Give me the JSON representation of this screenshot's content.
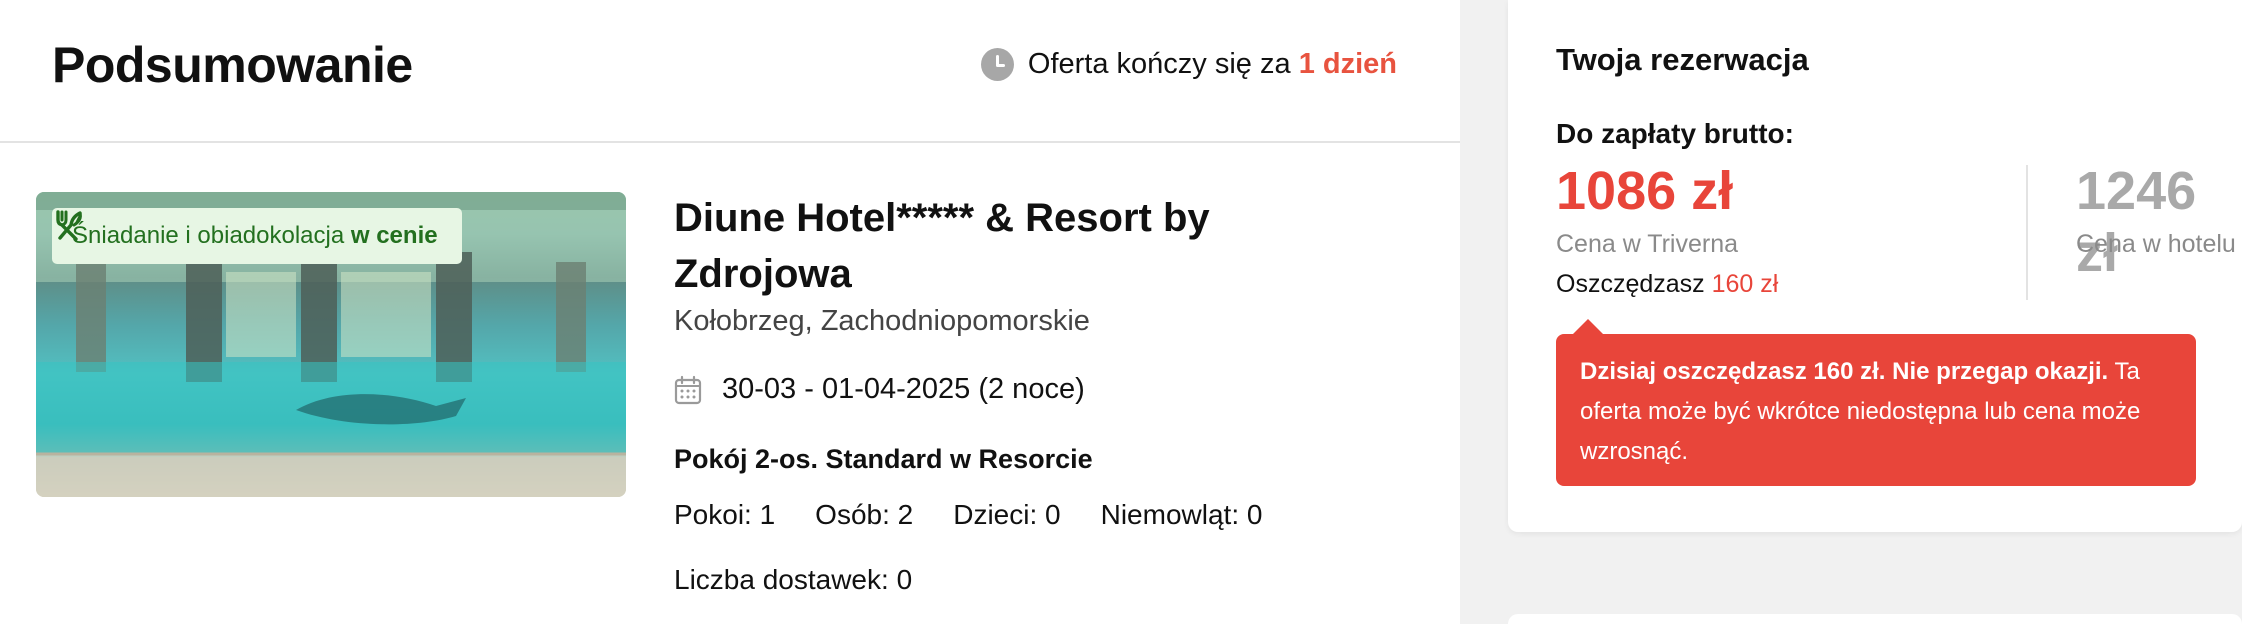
{
  "header": {
    "title": "Podsumowanie",
    "offer_prefix": "Oferta kończy się za",
    "offer_remaining": "1 dzień"
  },
  "hotel": {
    "badge_text": "Śniadanie i obiadokolacja",
    "badge_bold": "w cenie",
    "name": "Diune Hotel***** & Resort by Zdrojowa",
    "location": "Kołobrzeg, Zachodniopomorskie",
    "dates": "30-03 - 01-04-2025 (2 noce)",
    "room_type": "Pokój 2-os. Standard w Resorcie",
    "occupancy": {
      "rooms": "Pokoi: 1",
      "persons": "Osób: 2",
      "children": "Dzieci: 0",
      "infants": "Niemowląt: 0"
    },
    "extra_beds": "Liczba dostawek: 0"
  },
  "booking": {
    "title": "Twoja rezerwacja",
    "pay_label": "Do zapłaty brutto:",
    "price_triverna": "1086 zł",
    "price_triverna_caption": "Cena w Triverna",
    "savings_prefix": "Oszczędzasz",
    "savings_amount": "160 zł",
    "price_hotel": "1246 zł",
    "price_hotel_caption": "Cena w hotelu",
    "alert_bold": "Dzisiaj oszczędzasz 160 zł. Nie przegap okazji.",
    "alert_text": "Ta oferta może być wkrótce niedostępna lub cena może wzrosnąć."
  },
  "icons": {
    "clock": "clock-icon",
    "cutlery": "cutlery-icon",
    "calendar": "calendar-icon"
  },
  "colors": {
    "accent_red": "#e8453a",
    "badge_green": "#23701f",
    "badge_bg": "#e7f6e4"
  }
}
